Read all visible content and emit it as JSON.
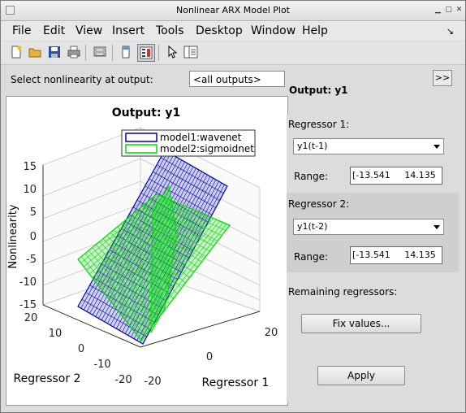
{
  "window": {
    "title": "Nonlinear ARX Model Plot"
  },
  "menu": [
    "File",
    "Edit",
    "View",
    "Insert",
    "Tools",
    "Desktop",
    "Window",
    "Help"
  ],
  "toolbar": {
    "icons": [
      "new-file-icon",
      "open-folder-icon",
      "save-icon",
      "print-icon",
      "print-preview-icon",
      "hide-toolbars-icon",
      "show-plot-tools-icon",
      "pointer-icon",
      "property-editor-icon"
    ]
  },
  "selector": {
    "label": "Select nonlinearity at output:",
    "value": "<all outputs>"
  },
  "right": {
    "forward_button": ">>",
    "output_title": "Output: y1",
    "reg1": {
      "label": "Regressor 1:",
      "value": "y1(t-1)",
      "range_label": "Range:",
      "range_value": "[-13.541     14.135"
    },
    "reg2": {
      "label": "Regressor 2:",
      "value": "y1(t-2)",
      "range_label": "Range:",
      "range_value": "[-13.541     14.135"
    },
    "remaining_label": "Remaining regressors:",
    "fix_button": "Fix values...",
    "apply_button": "Apply"
  },
  "plot": {
    "title": "Output: y1",
    "zlabel": "Nonlinearity",
    "xlabel": "Regressor 1",
    "ylabel": "Regressor 2",
    "zticks": [
      "15",
      "10",
      "5",
      "0",
      "-5",
      "-10",
      "-15"
    ],
    "xticks": [
      "-20",
      "0",
      "20"
    ],
    "yticks": [
      "20",
      "10",
      "0",
      "-10",
      "-20"
    ],
    "legend": [
      {
        "name": "model1:wavenet",
        "color": "#0000aa"
      },
      {
        "name": "model2:sigmoidnet",
        "color": "#00dd00"
      }
    ]
  }
}
